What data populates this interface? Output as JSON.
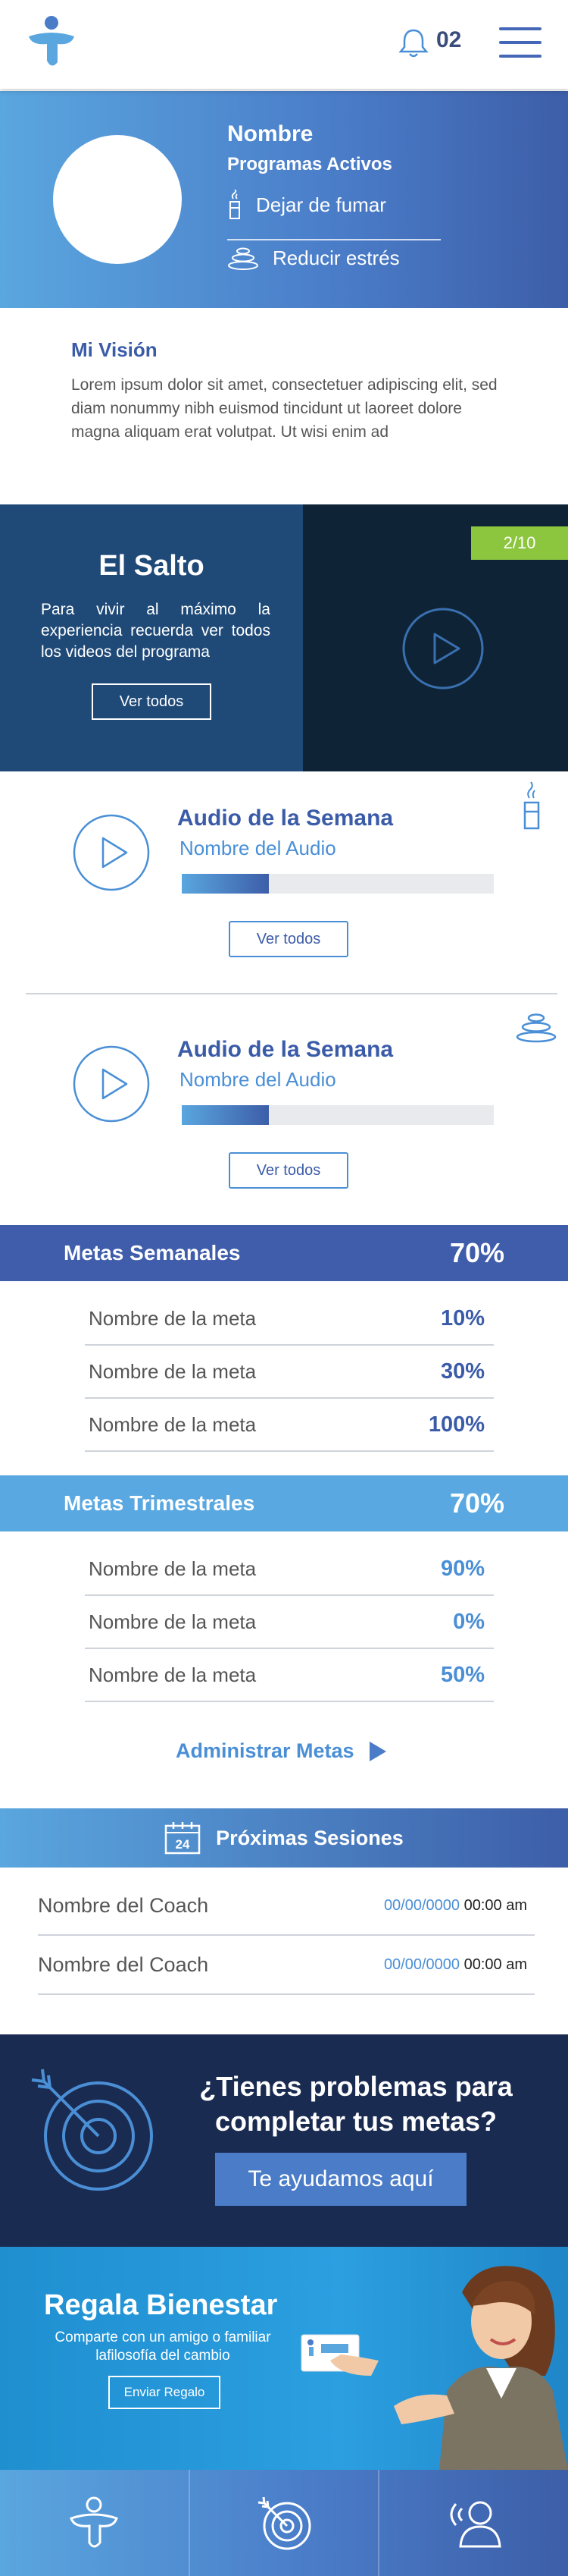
{
  "header": {
    "notification_count": "02"
  },
  "profile": {
    "name": "Nombre",
    "programs_title": "Programas Activos",
    "programs": [
      {
        "label": "Dejar de fumar",
        "icon": "cigarette-icon"
      },
      {
        "label": "Reducir estrés",
        "icon": "stones-icon"
      }
    ]
  },
  "vision": {
    "title": "Mi Visión",
    "text": "Lorem ipsum dolor sit amet, consectetuer adipiscing elit, sed diam nonummy nibh euismod tincidunt ut laoreet dolore magna aliquam erat volutpat. Ut wisi enim ad"
  },
  "salto": {
    "title": "El Salto",
    "text": "Para vivir al máximo la experiencia recuerda ver todos los videos del programa",
    "button": "Ver todos",
    "badge": "2/10"
  },
  "audios": [
    {
      "title": "Audio de la Semana",
      "name": "Nombre del Audio",
      "progress": 0.28,
      "button": "Ver todos",
      "icon": "cigarette-icon"
    },
    {
      "title": "Audio de la Semana",
      "name": "Nombre del Audio",
      "progress": 0.28,
      "button": "Ver todos",
      "icon": "stones-icon"
    }
  ],
  "metas_semanales": {
    "title": "Metas Semanales",
    "value": "70%",
    "items": [
      {
        "name": "Nombre de la meta",
        "value": "10%"
      },
      {
        "name": "Nombre de la meta",
        "value": "30%"
      },
      {
        "name": "Nombre de la meta",
        "value": "100%"
      }
    ]
  },
  "metas_trimestrales": {
    "title": "Metas Trimestrales",
    "value": "70%",
    "items": [
      {
        "name": "Nombre de la meta",
        "value": "90%"
      },
      {
        "name": "Nombre de la meta",
        "value": "0%"
      },
      {
        "name": "Nombre de la meta",
        "value": "50%"
      }
    ]
  },
  "admin_link": "Administrar Metas",
  "sesiones": {
    "title": "Próximas Sesiones",
    "calendar_day": "24",
    "items": [
      {
        "coach": "Nombre del Coach",
        "date": "00/00/0000",
        "time": "00:00 am"
      },
      {
        "coach": "Nombre del Coach",
        "date": "00/00/0000",
        "time": "00:00 am"
      }
    ]
  },
  "problemas": {
    "title": "¿Tienes problemas para completar tus metas?",
    "button": "Te ayudamos aquí"
  },
  "regala": {
    "title": "Regala Bienestar",
    "text": "Comparte con un amigo o familiar lafilosofía del cambio",
    "button": "Enviar Regalo"
  },
  "colors": {
    "primary_dark": "#3f5dab",
    "primary_light": "#5aa8e1",
    "accent_green": "#8cc63f",
    "navy": "#1a2b52",
    "meta_value_dark": "#3a5ba8",
    "meta_value_light": "#4a8fd6"
  }
}
